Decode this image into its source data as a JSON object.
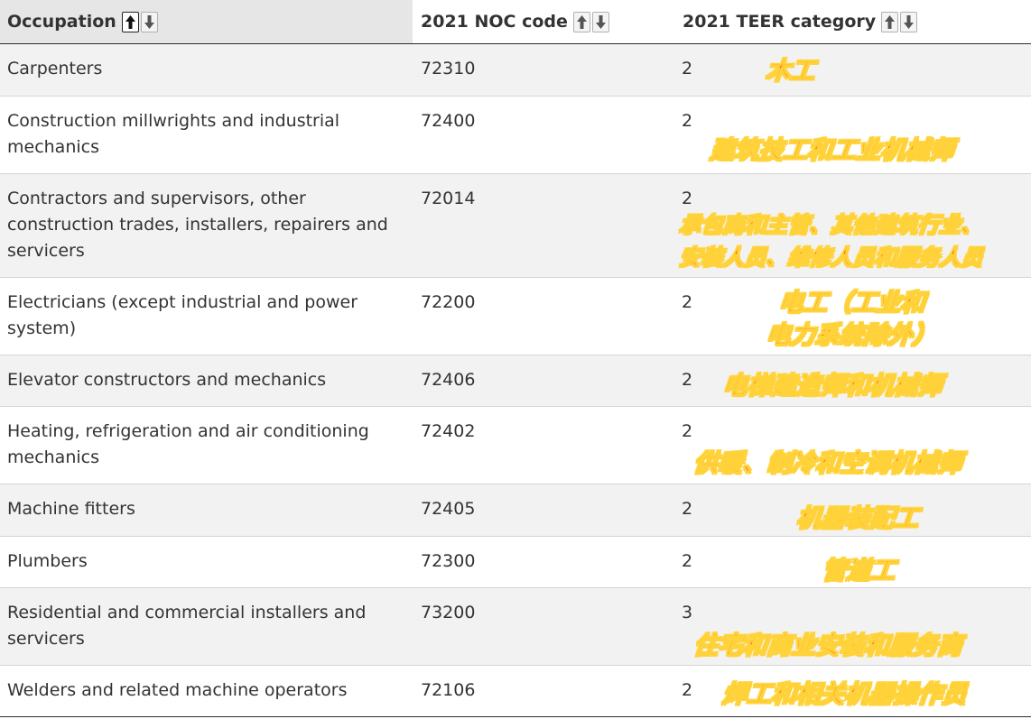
{
  "table": {
    "headers": {
      "occupation": "Occupation",
      "noc": "2021 NOC code",
      "teer": "2021 TEER category"
    },
    "rows": [
      {
        "occupation": "Carpenters",
        "noc": "72310",
        "teer": "2",
        "zh": [
          "木工"
        ]
      },
      {
        "occupation": "Construction millwrights and industrial mechanics",
        "noc": "72400",
        "teer": "2",
        "zh": [
          "建筑技工和工业机械师"
        ]
      },
      {
        "occupation": "Contractors and supervisors, other construction trades, installers, repairers and servicers",
        "noc": "72014",
        "teer": "2",
        "zh": [
          "承包商和主管、其他建筑行业、",
          "安装人员、维修人员和服务人员"
        ]
      },
      {
        "occupation": "Electricians (except industrial and power system)",
        "noc": "72200",
        "teer": "2",
        "zh": [
          "电工（工业和",
          "电力系统除外）"
        ]
      },
      {
        "occupation": "Elevator constructors and mechanics",
        "noc": "72406",
        "teer": "2",
        "zh": [
          "电梯建造师和机械师"
        ]
      },
      {
        "occupation": "Heating, refrigeration and air conditioning mechanics",
        "noc": "72402",
        "teer": "2",
        "zh": [
          "供暖、制冷和空调机械师"
        ]
      },
      {
        "occupation": "Machine fitters",
        "noc": "72405",
        "teer": "2",
        "zh": [
          "机器装配工"
        ]
      },
      {
        "occupation": "Plumbers",
        "noc": "72300",
        "teer": "2",
        "zh": [
          "管道工"
        ]
      },
      {
        "occupation": "Residential and commercial installers and servicers",
        "noc": "73200",
        "teer": "3",
        "zh": [
          "住宅和商业安装和服务商"
        ]
      },
      {
        "occupation": "Welders and related machine operators",
        "noc": "72106",
        "teer": "2",
        "zh": [
          "焊工和相关机器操作员"
        ]
      }
    ]
  },
  "sort_icons": {
    "up": "sort-ascending-icon",
    "down": "sort-descending-icon",
    "active": "occupation-ascending"
  },
  "colors": {
    "header_active_bg": "#e6e6e6",
    "row_stripe": "#f2f2f2",
    "overlay_text": "#ff5a14",
    "overlay_outline": "#ffd23a"
  }
}
